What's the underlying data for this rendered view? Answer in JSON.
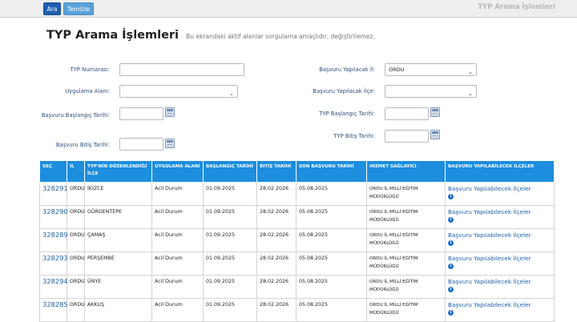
{
  "toolbar": {
    "search_label": "Ara",
    "clear_label": "Temizle",
    "right_title": "TYP Arama İşlemleri"
  },
  "header": {
    "title": "TYP Arama İşlemleri",
    "subtitle": "Bu ekrandaki aktif alanlar sorgulama amaçlıdır, değiştirilemez."
  },
  "form": {
    "typ_no_label": "TYP Numarası:",
    "typ_no_value": "",
    "uygulama_label": "Uygulama Alanı:",
    "uygulama_value": "",
    "bas_bas_label": "Başvuru Başlangıç Tarihi:",
    "bas_bas_value": "",
    "bas_bit_label": "Başvuru Bitiş Tarihi:",
    "bas_bit_value": "",
    "il_label": "Başvuru Yapılacak İl:",
    "il_value": "ORDU",
    "ilce_label": "Başvuru Yapılacak İlçe:",
    "ilce_value": "",
    "typ_bas_label": "TYP Başlangıç Tarihi:",
    "typ_bas_value": "",
    "typ_bit_label": "TYP Bitiş Tarihi:",
    "typ_bit_value": ""
  },
  "table": {
    "headers": [
      "SEÇ",
      "İL",
      "TYP'NİN DÜZENLENDİĞİ İLÇE",
      "UYGULAMA ALANI",
      "BAŞLANGIÇ TARİHİ",
      "BİTİŞ TARİHİ",
      "SON BAŞVURU TARİHİ",
      "HİZMET SAĞLAYICI",
      "BAŞVURU YAPILABİLECEK İLÇELER"
    ],
    "rows": [
      {
        "id": "328291",
        "il": "ORDU",
        "ilce": "İKİZCE",
        "alan": "Acil Durum",
        "bas": "01.09.2025",
        "bit": "28.02.2026",
        "son": "05.08.2025",
        "hizmet": "ORDU İL MİLLİ EĞİTİM MÜDÜRLÜĞÜ",
        "link": "Başvuru Yapılabilecek İlçeler"
      },
      {
        "id": "328290",
        "il": "ORDU",
        "ilce": "GÜRGENTEPE",
        "alan": "Acil Durum",
        "bas": "01.09.2025",
        "bit": "28.02.2026",
        "son": "05.08.2025",
        "hizmet": "ORDU İL MİLLİ EĞİTİM MÜDÜRLÜĞÜ",
        "link": "Başvuru Yapılabilecek İlçeler"
      },
      {
        "id": "328289",
        "il": "ORDU",
        "ilce": "ÇAMAŞ",
        "alan": "Acil Durum",
        "bas": "01.09.2025",
        "bit": "28.02.2026",
        "son": "05.08.2025",
        "hizmet": "ORDU İL MİLLİ EĞİTİM MÜDÜRLÜĞÜ",
        "link": "Başvuru Yapılabilecek İlçeler"
      },
      {
        "id": "328293",
        "il": "ORDU",
        "ilce": "PERŞEMBE",
        "alan": "Acil Durum",
        "bas": "01.09.2025",
        "bit": "28.02.2026",
        "son": "05.08.2025",
        "hizmet": "ORDU İL MİLLİ EĞİTİM MÜDÜRLÜĞÜ",
        "link": "Başvuru Yapılabilecek İlçeler"
      },
      {
        "id": "328294",
        "il": "ORDU",
        "ilce": "ÜNYE",
        "alan": "Acil Durum",
        "bas": "01.09.2025",
        "bit": "28.02.2026",
        "son": "05.08.2025",
        "hizmet": "ORDU İL MİLLİ EĞİTİM MÜDÜRLÜĞÜ",
        "link": "Başvuru Yapılabilecek İlçeler"
      },
      {
        "id": "328285",
        "il": "ORDU",
        "ilce": "AKKUŞ",
        "alan": "Acil Durum",
        "bas": "01.09.2025",
        "bit": "28.02.2026",
        "son": "05.08.2025",
        "hizmet": "ORDU İL MİLLİ EĞİTİM MÜDÜRLÜĞÜ",
        "link": "Başvuru Yapılabilecek İlçeler"
      }
    ]
  },
  "icons": {
    "calendar": "calendar-icon",
    "info": "info-icon",
    "dropdown": "chevron-down-icon"
  }
}
